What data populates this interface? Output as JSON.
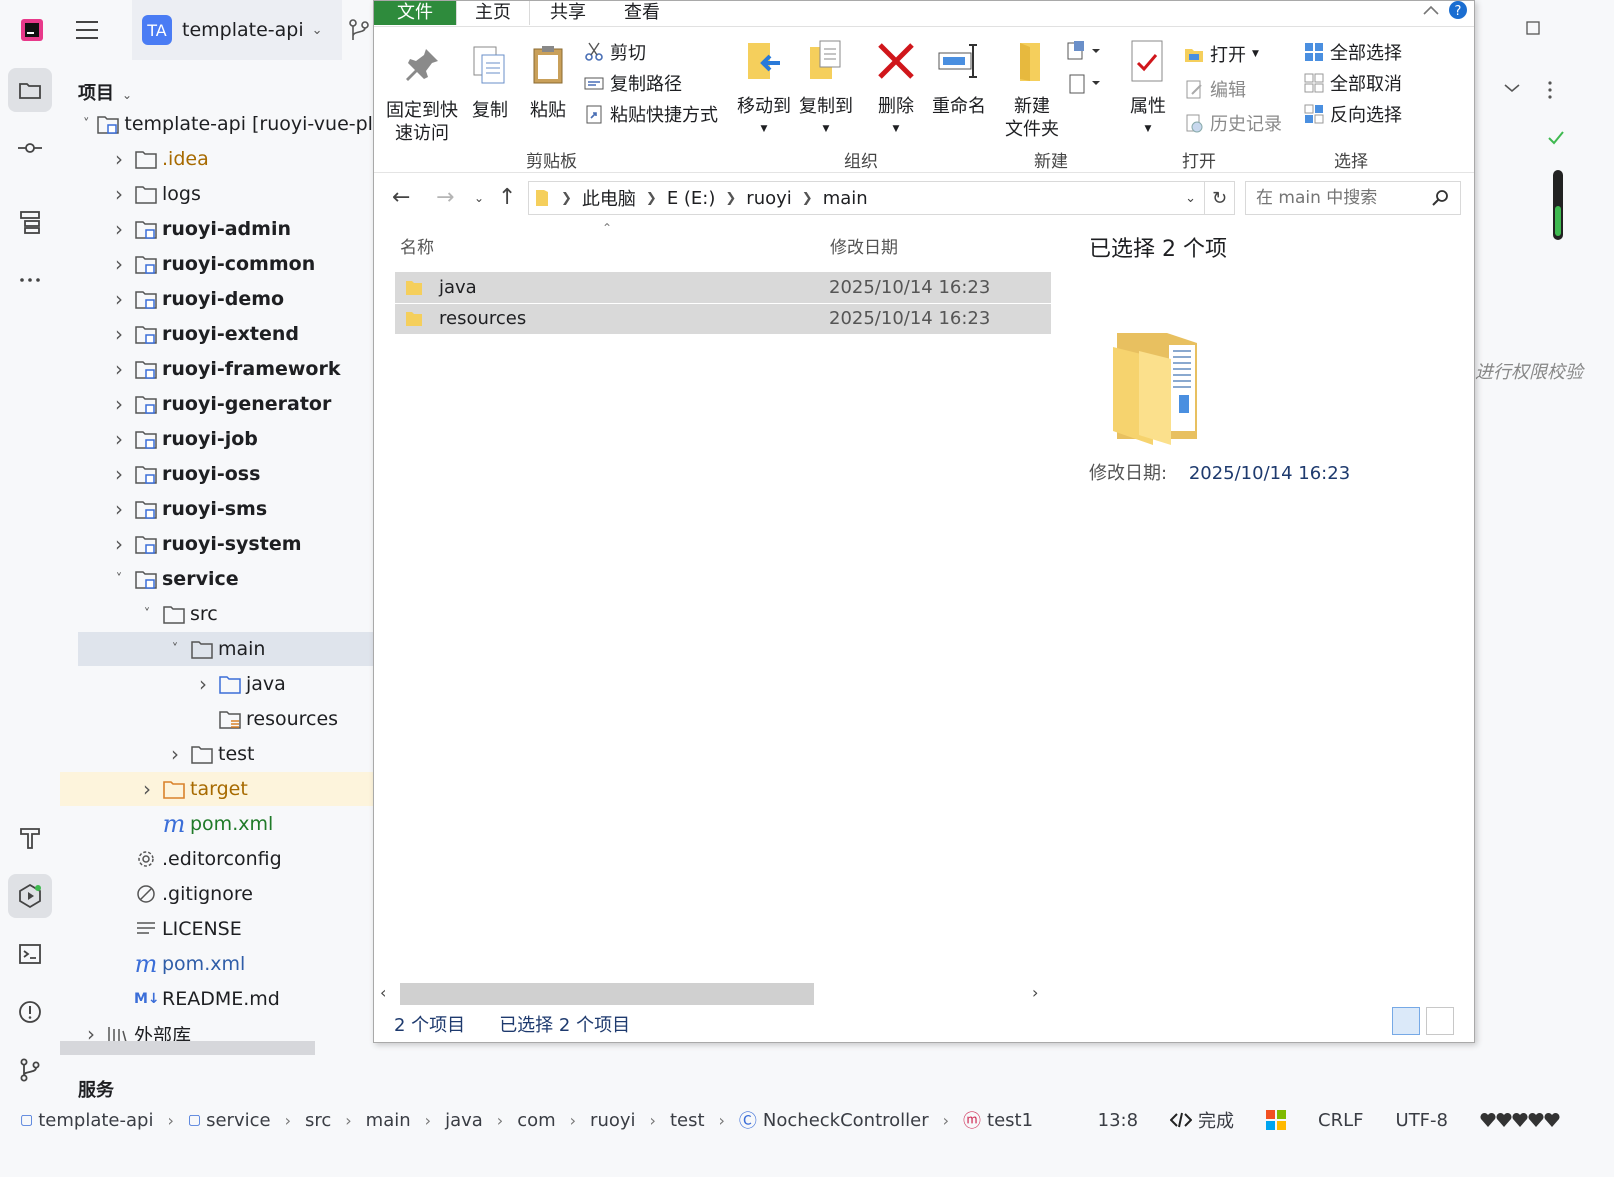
{
  "ide": {
    "project_name": "template-api",
    "project_badge": "TA",
    "panel_title": "项目",
    "services_label": "服务",
    "tree": [
      {
        "label": "template-api [ruoyi-vue-plu",
        "indent": 0,
        "arrow": "open",
        "icon": "module",
        "style": "normal"
      },
      {
        "label": ".idea",
        "indent": 1,
        "arrow": "closed",
        "icon": "folder",
        "style": "gold"
      },
      {
        "label": "logs",
        "indent": 1,
        "arrow": "closed",
        "icon": "folder",
        "style": "normal"
      },
      {
        "label": "ruoyi-admin",
        "indent": 1,
        "arrow": "closed",
        "icon": "module",
        "style": "bold"
      },
      {
        "label": "ruoyi-common",
        "indent": 1,
        "arrow": "closed",
        "icon": "module",
        "style": "bold"
      },
      {
        "label": "ruoyi-demo",
        "indent": 1,
        "arrow": "closed",
        "icon": "module",
        "style": "bold"
      },
      {
        "label": "ruoyi-extend",
        "indent": 1,
        "arrow": "closed",
        "icon": "module",
        "style": "bold"
      },
      {
        "label": "ruoyi-framework",
        "indent": 1,
        "arrow": "closed",
        "icon": "module",
        "style": "bold"
      },
      {
        "label": "ruoyi-generator",
        "indent": 1,
        "arrow": "closed",
        "icon": "module",
        "style": "bold"
      },
      {
        "label": "ruoyi-job",
        "indent": 1,
        "arrow": "closed",
        "icon": "module",
        "style": "bold"
      },
      {
        "label": "ruoyi-oss",
        "indent": 1,
        "arrow": "closed",
        "icon": "module",
        "style": "bold"
      },
      {
        "label": "ruoyi-sms",
        "indent": 1,
        "arrow": "closed",
        "icon": "module",
        "style": "bold"
      },
      {
        "label": "ruoyi-system",
        "indent": 1,
        "arrow": "closed",
        "icon": "module",
        "style": "bold"
      },
      {
        "label": "service",
        "indent": 1,
        "arrow": "open",
        "icon": "module",
        "style": "bold"
      },
      {
        "label": "src",
        "indent": 2,
        "arrow": "open",
        "icon": "folder",
        "style": "normal"
      },
      {
        "label": "main",
        "indent": 3,
        "arrow": "open",
        "icon": "folder",
        "style": "normal",
        "selected": true
      },
      {
        "label": "java",
        "indent": 4,
        "arrow": "closed",
        "icon": "folder-blue",
        "style": "normal"
      },
      {
        "label": "resources",
        "indent": 4,
        "arrow": "none",
        "icon": "folder-res",
        "style": "normal"
      },
      {
        "label": "test",
        "indent": 3,
        "arrow": "closed",
        "icon": "folder",
        "style": "normal"
      },
      {
        "label": "target",
        "indent": 2,
        "arrow": "closed",
        "icon": "folder-orange",
        "style": "target",
        "excluded": true
      },
      {
        "label": "pom.xml",
        "indent": 2,
        "arrow": "none",
        "icon": "maven",
        "style": "green"
      },
      {
        "label": ".editorconfig",
        "indent": 1,
        "arrow": "none",
        "icon": "gear",
        "style": "normal"
      },
      {
        "label": ".gitignore",
        "indent": 1,
        "arrow": "none",
        "icon": "ignore",
        "style": "normal"
      },
      {
        "label": "LICENSE",
        "indent": 1,
        "arrow": "none",
        "icon": "text",
        "style": "normal"
      },
      {
        "label": "pom.xml",
        "indent": 1,
        "arrow": "none",
        "icon": "maven",
        "style": "blue"
      },
      {
        "label": "README.md",
        "indent": 1,
        "arrow": "none",
        "icon": "markdown",
        "style": "normal"
      },
      {
        "label": "外部库",
        "indent": 0,
        "arrow": "closed",
        "icon": "library",
        "style": "normal"
      }
    ],
    "breadcrumb": [
      "template-api",
      "service",
      "src",
      "main",
      "java",
      "com",
      "ruoyi",
      "test",
      "NocheckController",
      "test1"
    ],
    "status": {
      "position": "13:8",
      "ai_status": "完成",
      "line_ending": "CRLF",
      "encoding": "UTF-8"
    },
    "side_hint": "进行权限校验"
  },
  "explorer": {
    "tabs": [
      "文件",
      "主页",
      "共享",
      "查看"
    ],
    "ribbon": {
      "pin": "固定到快\n速访问",
      "copy": "复制",
      "paste": "粘贴",
      "cut": "剪切",
      "copy_path": "复制路径",
      "paste_shortcut": "粘贴快捷方式",
      "move_to": "移动到",
      "copy_to": "复制到",
      "delete": "删除",
      "rename": "重命名",
      "new_folder": "新建\n文件夹",
      "properties": "属性",
      "open": "打开",
      "edit": "编辑",
      "history": "历史记录",
      "select_all": "全部选择",
      "select_none": "全部取消",
      "invert_selection": "反向选择",
      "groups": [
        "剪贴板",
        "组织",
        "新建",
        "打开",
        "选择"
      ]
    },
    "address": [
      "此电脑",
      "E (E:)",
      "ruoyi",
      "main"
    ],
    "search_placeholder": "在 main 中搜索",
    "columns": {
      "name": "名称",
      "date": "修改日期"
    },
    "files": [
      {
        "name": "java",
        "date": "2025/10/14 16:23"
      },
      {
        "name": "resources",
        "date": "2025/10/14 16:23"
      }
    ],
    "details": {
      "selected_title": "已选择 2 个项",
      "modified_label": "修改日期:",
      "modified_value": "2025/10/14 16:23"
    },
    "status": {
      "count": "2 个项目",
      "selected": "已选择 2 个项目"
    },
    "colors": {
      "file_tab": "#2e8b3c",
      "selection": "#d9d9d9",
      "folder": "#f5cf5c"
    }
  }
}
